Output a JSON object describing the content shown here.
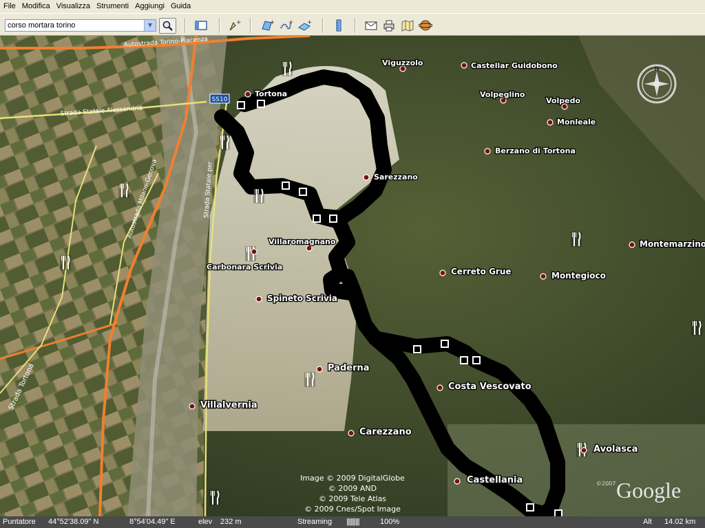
{
  "menu": [
    "File",
    "Modifica",
    "Visualizza",
    "Strumenti",
    "Aggiungi",
    "Guida"
  ],
  "toolbar": {
    "search_value": "corso mortara torino",
    "icons": [
      "search-icon",
      "sidebar-toggle-icon",
      "placemark-add-icon",
      "polygon-add-icon",
      "path-add-icon",
      "overlay-add-icon",
      "ruler-icon",
      "email-icon",
      "print-icon",
      "maps-icon",
      "sky-icon"
    ]
  },
  "map": {
    "places": [
      {
        "name": "Viguzzolo"
      },
      {
        "name": "Castellar Guidobono"
      },
      {
        "name": "Tortona"
      },
      {
        "name": "Volpeglino"
      },
      {
        "name": "Volpedo"
      },
      {
        "name": "Monleale"
      },
      {
        "name": "Berzano di Tortona"
      },
      {
        "name": "Sarezzano"
      },
      {
        "name": "Montemarzino"
      },
      {
        "name": "Villaromagnano"
      },
      {
        "name": "Carbonara Scrivia"
      },
      {
        "name": "Cerreto Grue"
      },
      {
        "name": "Montegioco"
      },
      {
        "name": "Spineto Scrivia"
      },
      {
        "name": "Paderna"
      },
      {
        "name": "Costa Vescovato"
      },
      {
        "name": "Villalvernia"
      },
      {
        "name": "Carezzano"
      },
      {
        "name": "Avolasca"
      },
      {
        "name": "Castellania"
      }
    ],
    "roads": {
      "motorway_top": "Autostrada Torino-Piacenza",
      "statale_alessandria": "Strada Statale Alessandria",
      "milano_genova": "Autostrada Milano-Genova",
      "strada_tortona": "Strada Tortona",
      "statale_vertical": "Strada Statale per"
    },
    "shield": "SS10",
    "compass_label": "N",
    "copyright_lines": [
      "Image © 2009 DigitalGlobe",
      "© 2009 AND",
      "© 2009 Tele Atlas",
      "© 2009 Cnes/Spot Image"
    ],
    "logo": "Google",
    "logo_year": "©2007",
    "track_color": "#000000"
  },
  "status": {
    "puntatore_label": "Puntatore",
    "lat": "44°52'38.09\" N",
    "lon": "8°54'04.49\" E",
    "elev_label": "elev",
    "elev_value": "232 m",
    "streaming_label": "Streaming",
    "streaming_bar": "||||||||||",
    "streaming_pct": "100%",
    "alt_label": "Alt",
    "alt_value": "14.02 km"
  }
}
